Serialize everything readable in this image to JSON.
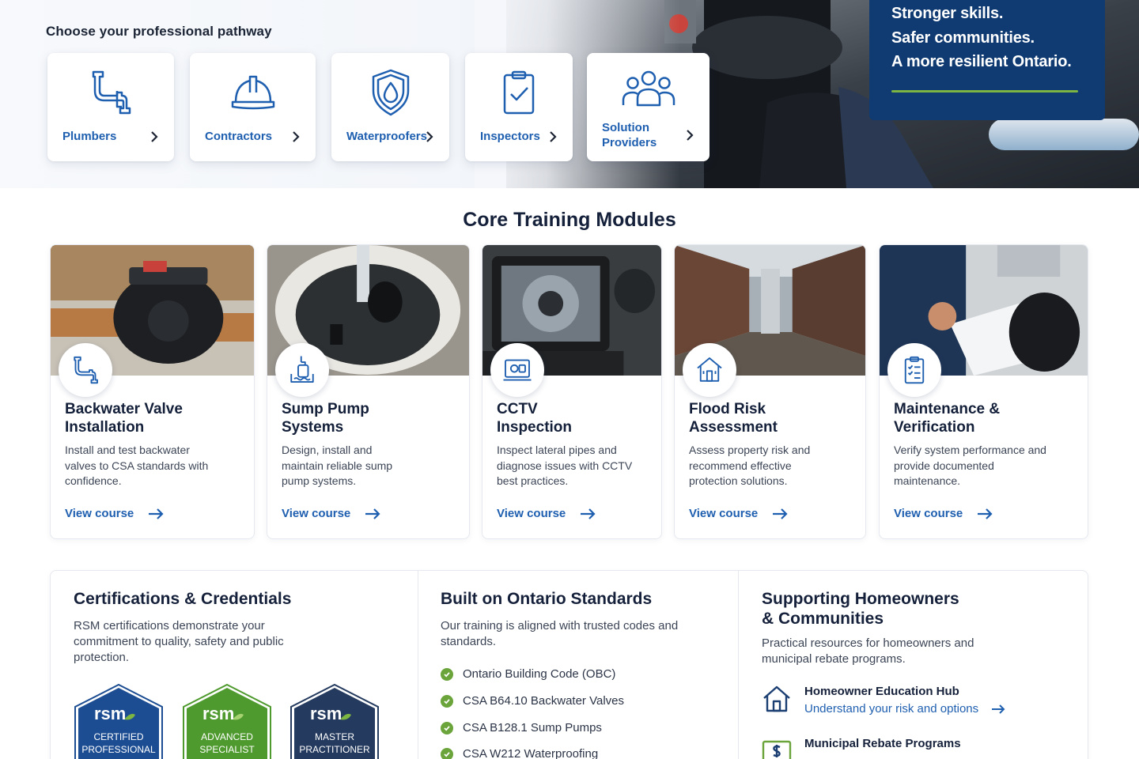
{
  "pathways": {
    "heading": "Choose your professional pathway",
    "cards": [
      {
        "label": "Plumbers",
        "icon": "pipe-icon"
      },
      {
        "label": "Contractors",
        "icon": "hard-hat-icon"
      },
      {
        "label": "Waterproofers",
        "icon": "shield-drop-icon"
      },
      {
        "label": "Inspectors",
        "icon": "clipboard-check-icon"
      },
      {
        "label": "Solution Providers",
        "icon": "people-group-icon"
      }
    ]
  },
  "hero": {
    "tagline": [
      "Stronger skills.",
      "Safer communities.",
      "A more resilient Ontario."
    ]
  },
  "core": {
    "heading": "Core Training Modules",
    "link_label": "View course",
    "modules": [
      {
        "title": "Backwater Valve Installation",
        "desc": "Install and test backwater valves to CSA standards with confidence.",
        "icon": "pipe-icon"
      },
      {
        "title": "Sump Pump Systems",
        "desc": "Design, install and maintain reliable sump pump systems.",
        "icon": "sump-pump-icon"
      },
      {
        "title": "CCTV Inspection",
        "desc": "Inspect lateral pipes and diagnose issues with CCTV best practices.",
        "icon": "monitor-camera-icon"
      },
      {
        "title": "Flood Risk Assessment",
        "desc": "Assess property risk and recommend effective protection solutions.",
        "icon": "house-flood-icon"
      },
      {
        "title": "Maintenance & Verification",
        "desc": "Verify system performance and provide documented maintenance.",
        "icon": "checklist-icon"
      }
    ]
  },
  "certifications": {
    "title": "Certifications & Credentials",
    "text": "RSM certifications demonstrate your commitment to quality, safety and public protection.",
    "badges": [
      {
        "brand": "rsm",
        "line1": "CERTIFIED",
        "line2": "PROFESSIONAL",
        "color": "#1c4d92"
      },
      {
        "brand": "rsm",
        "line1": "ADVANCED",
        "line2": "SPECIALIST",
        "color": "#4f9a2e"
      },
      {
        "brand": "rsm",
        "line1": "MASTER",
        "line2": "PRACTITIONER",
        "color": "#243a5e"
      }
    ]
  },
  "standards": {
    "title": "Built on Ontario Standards",
    "text": "Our training is aligned with trusted codes and standards.",
    "items": [
      "Ontario Building Code (OBC)",
      "CSA B64.10 Backwater Valves",
      "CSA B128.1 Sump Pumps",
      "CSA W212 Waterproofing"
    ]
  },
  "homeowners": {
    "title": "Supporting Homeowners & Communities",
    "text": "Practical resources for homeowners and municipal rebate programs.",
    "resources": [
      {
        "title": "Homeowner Education Hub",
        "link": "Understand your risk and options",
        "icon": "house-icon"
      },
      {
        "title": "Municipal Rebate Programs",
        "link": "",
        "icon": "dollar-bill-icon"
      }
    ]
  },
  "colors": {
    "navy": "#0f3a72",
    "link": "#1f5fb0",
    "green": "#7db542"
  }
}
